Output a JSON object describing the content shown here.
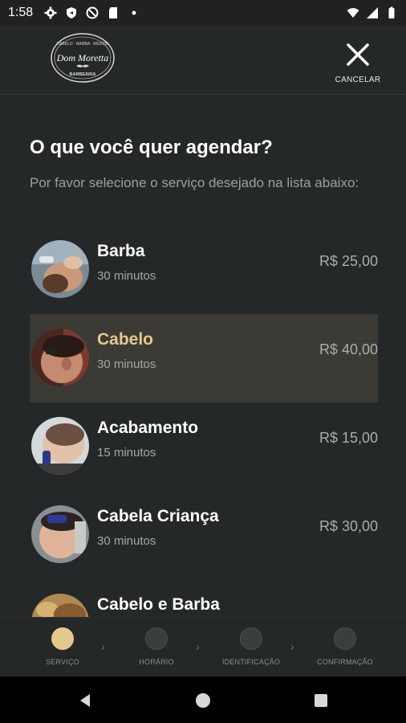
{
  "status_bar": {
    "time": "1:58",
    "icons": [
      "gear-icon",
      "shield-icon",
      "blocked-icon",
      "sd-card-icon",
      "dot-icon"
    ],
    "right_icons": [
      "wifi-icon",
      "signal-icon",
      "battery-icon"
    ]
  },
  "header": {
    "logo": {
      "top_text": "CABELO · BARBA · BIGODE",
      "name": "Dom Moretta",
      "bottom_text": "BARBEARIA"
    },
    "cancel_label": "CANCELAR"
  },
  "main": {
    "title": "O que você quer agendar?",
    "subtitle": "Por favor selecione o serviço desejado na lista abaixo:",
    "services": [
      {
        "name": "Barba",
        "duration": "30 minutos",
        "price": "R$ 25,00",
        "selected": false
      },
      {
        "name": "Cabelo",
        "duration": "30 minutos",
        "price": "R$ 40,00",
        "selected": true
      },
      {
        "name": "Acabamento",
        "duration": "15 minutos",
        "price": "R$ 15,00",
        "selected": false
      },
      {
        "name": "Cabela Criança",
        "duration": "30 minutos",
        "price": "R$ 30,00",
        "selected": false
      },
      {
        "name": "Cabelo e Barba",
        "duration": "",
        "price": "",
        "selected": false
      }
    ]
  },
  "stepper": {
    "steps": [
      {
        "label": "SERVIÇO",
        "active": true
      },
      {
        "label": "HORÁRIO",
        "active": false
      },
      {
        "label": "IDENTIFICAÇÃO",
        "active": false
      },
      {
        "label": "CONFIRMAÇÃO",
        "active": false
      }
    ]
  },
  "colors": {
    "background": "#252828",
    "accent": "#e3c98d",
    "selected_row": "#3b3a34",
    "muted_text": "#9aa0a0"
  }
}
